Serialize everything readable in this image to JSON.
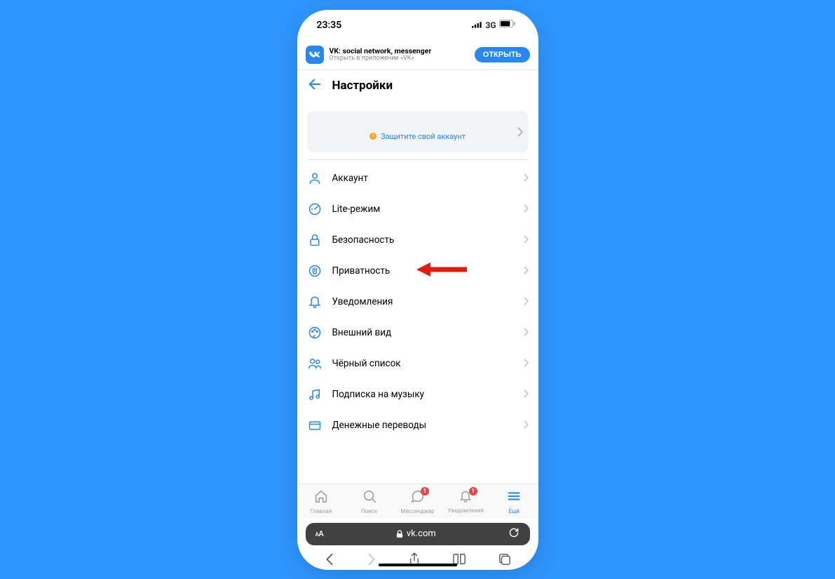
{
  "status": {
    "time": "23:35",
    "network": "3G"
  },
  "banner": {
    "title": "VK: social network, messenger",
    "subtitle": "Открыть в приложении «VK»",
    "button": "ОТКРЫТЬ"
  },
  "header": {
    "title": "Настройки"
  },
  "protect": {
    "text": "Защитите свой аккаунт"
  },
  "menu": [
    {
      "label": "Аккаунт",
      "icon": "user"
    },
    {
      "label": "Lite-режим",
      "icon": "gauge"
    },
    {
      "label": "Безопасность",
      "icon": "lock"
    },
    {
      "label": "Приватность",
      "icon": "hand",
      "highlight": true
    },
    {
      "label": "Уведомления",
      "icon": "bell"
    },
    {
      "label": "Внешний вид",
      "icon": "palette"
    },
    {
      "label": "Чёрный список",
      "icon": "users"
    },
    {
      "label": "Подписка на музыку",
      "icon": "music"
    },
    {
      "label": "Денежные переводы",
      "icon": "card"
    }
  ],
  "nav": [
    {
      "label": "Главная",
      "icon": "home"
    },
    {
      "label": "Поиск",
      "icon": "search"
    },
    {
      "label": "Мессенджер",
      "icon": "message",
      "badge": "1"
    },
    {
      "label": "Уведомления",
      "icon": "bell",
      "badge": "1"
    },
    {
      "label": "Ещё",
      "icon": "menu",
      "active": true
    }
  ],
  "safari": {
    "url": "vk.com",
    "aa": "AA"
  }
}
